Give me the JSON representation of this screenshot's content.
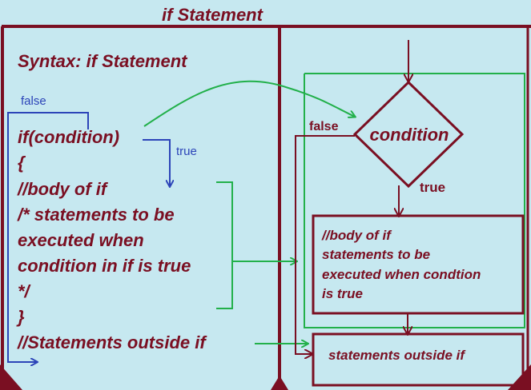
{
  "title": "if Statement",
  "left_panel": {
    "syntax_heading": "Syntax: if Statement",
    "false_label": "false",
    "true_label": "true",
    "code_lines": [
      "if(condition)",
      "{",
      "//body of if",
      "/* statements to be",
      "executed when",
      "condition in if is true",
      "*/",
      "}",
      "//Statements outside if"
    ]
  },
  "flowchart": {
    "condition_label": "condition",
    "false_label": "false",
    "true_label": "true",
    "body_box_lines": [
      "//body of if",
      "statements to be",
      "executed when condtion",
      "is true"
    ],
    "outside_box_label": "statements outside if"
  },
  "colors": {
    "background": "#c6e8f0",
    "maroon": "#7a0f22",
    "green": "#22b04a",
    "blue": "#2c44b8"
  }
}
